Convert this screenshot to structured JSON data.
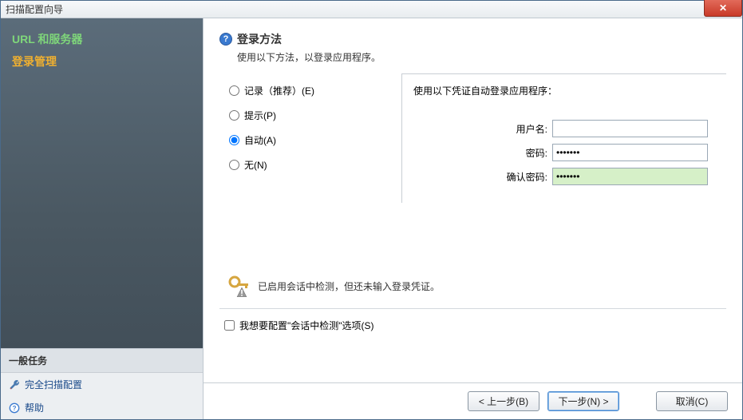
{
  "window": {
    "title": "扫描配置向导"
  },
  "sidebar": {
    "steps": [
      {
        "label": "URL 和服务器",
        "state": "complete"
      },
      {
        "label": "登录管理",
        "state": "active"
      }
    ],
    "general_tasks_header": "一般任务",
    "full_config_link": "完全扫描配置",
    "help_link": "帮助"
  },
  "main": {
    "title": "登录方法",
    "subtitle": "使用以下方法，以登录应用程序。",
    "radios": {
      "record": "记录（推荐）(E)",
      "prompt": "提示(P)",
      "auto": "自动(A)",
      "none": "无(N)",
      "selected": "auto"
    },
    "credentials": {
      "heading": "使用以下凭证自动登录应用程序：",
      "username_label": "用户名:",
      "username_value": "",
      "password_label": "密码:",
      "password_value": "•••••••",
      "confirm_label": "确认密码:",
      "confirm_value": "•••••••"
    },
    "warning": "已启用会话中检测，但还未输入登录凭证。",
    "session_checkbox_label": "我想要配置\"会话中检测\"选项(S)",
    "session_checked": false
  },
  "footer": {
    "back": "< 上一步(B)",
    "next": "下一步(N) >",
    "cancel": "取消(C)"
  }
}
